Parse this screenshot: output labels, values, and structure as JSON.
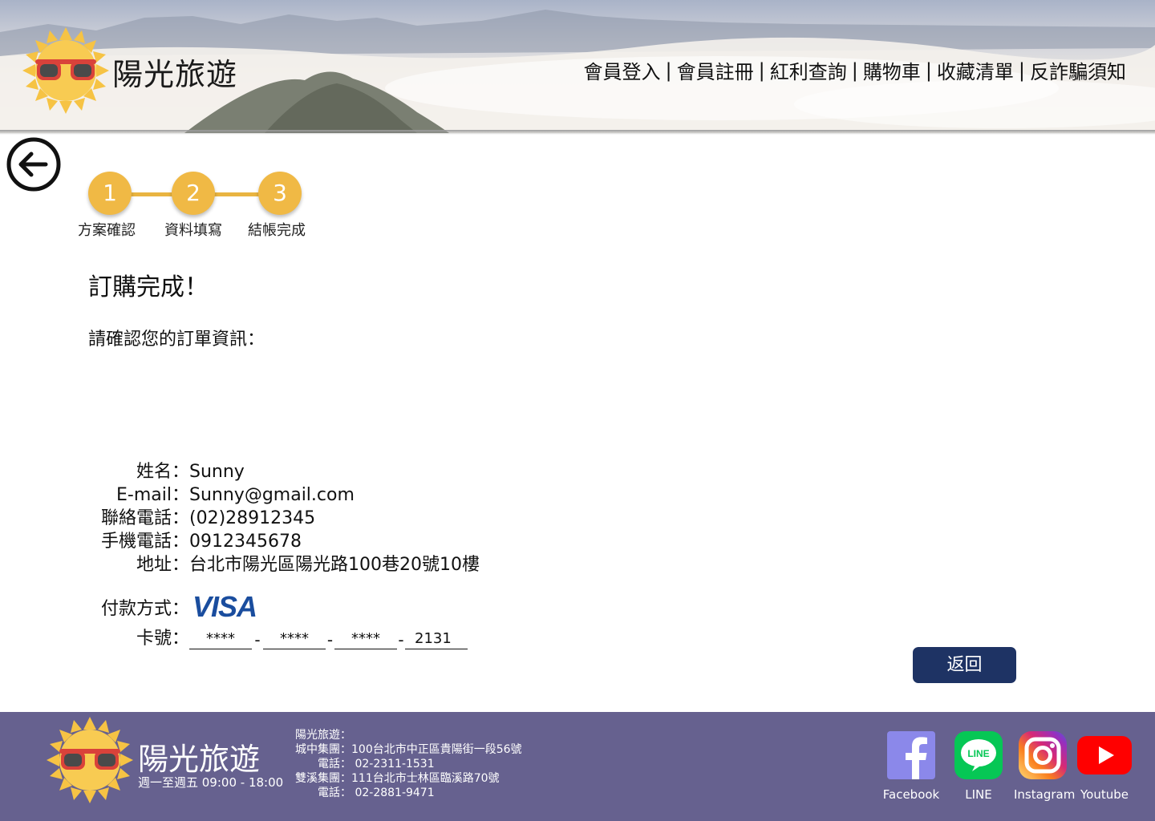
{
  "header": {
    "brand": "陽光旅遊",
    "nav": [
      {
        "label": "會員登入"
      },
      {
        "label": "會員註冊"
      },
      {
        "label": "紅利查詢"
      },
      {
        "label": "購物車"
      },
      {
        "label": "收藏清單"
      },
      {
        "label": "反詐騙須知"
      }
    ],
    "nav_separator": "|"
  },
  "stepper": {
    "steps": [
      {
        "number": "1",
        "label": "方案確認"
      },
      {
        "number": "2",
        "label": "資料填寫"
      },
      {
        "number": "3",
        "label": "結帳完成"
      }
    ],
    "accent_color": "#f0b945"
  },
  "main": {
    "title": "訂購完成！",
    "subtitle": "請確認您的訂單資訊：",
    "fields": [
      {
        "label": "姓名：",
        "value": "Sunny"
      },
      {
        "label": "E-mail：",
        "value": "Sunny@gmail.com"
      },
      {
        "label": "聯絡電話：",
        "value": "(02)28912345"
      },
      {
        "label": "手機電話：",
        "value": "0912345678"
      },
      {
        "label": "地址：",
        "value": "台北市陽光區陽光路100巷20號10樓"
      }
    ],
    "payment": {
      "label": "付款方式：",
      "method": "VISA"
    },
    "card": {
      "label": "卡號：",
      "segments": [
        "****",
        "****",
        "****",
        "2131"
      ],
      "separator": "-"
    },
    "return_button": "返回"
  },
  "footer": {
    "brand": "陽光旅遊",
    "hours": "週一至週五 09:00 - 18:00",
    "address_lines": [
      "陽光旅遊：",
      "城中集團：100台北市中正區貴陽街一段56號",
      "電話： 02-2311-1531",
      "雙溪集團：111台北市士林區臨溪路70號",
      "電話： 02-2881-9471"
    ],
    "social": [
      {
        "label": "Facebook",
        "icon": "facebook-icon",
        "color": "#8b88ea"
      },
      {
        "label": "LINE",
        "icon": "line-icon",
        "color": "#06c755"
      },
      {
        "label": "Instagram",
        "icon": "instagram-icon",
        "color": "#c13584"
      },
      {
        "label": "Youtube",
        "icon": "youtube-icon",
        "color": "#ff0000"
      }
    ],
    "background_color": "#66618f"
  },
  "colors": {
    "primary_button": "#1e3364",
    "sun_yellow": "#f6c344",
    "sunglass_red": "#d9423a"
  }
}
